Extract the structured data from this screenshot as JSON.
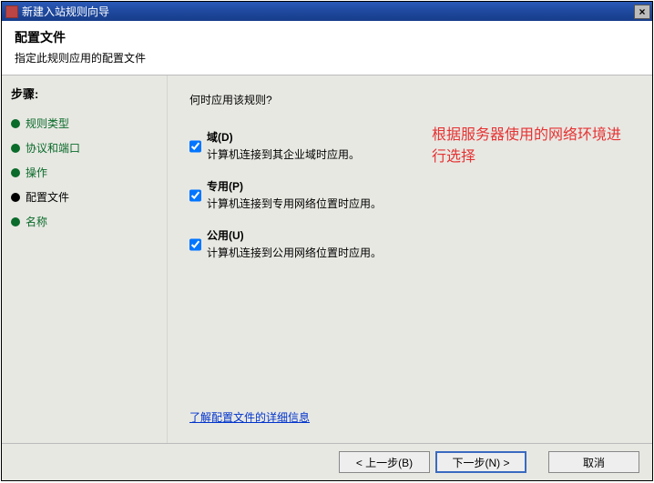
{
  "titlebar": {
    "title": "新建入站规则向导"
  },
  "header": {
    "title": "配置文件",
    "subtitle": "指定此规则应用的配置文件"
  },
  "sidebar": {
    "steps_title": "步骤:",
    "items": [
      {
        "label": "规则类型"
      },
      {
        "label": "协议和端口"
      },
      {
        "label": "操作"
      },
      {
        "label": "配置文件"
      },
      {
        "label": "名称"
      }
    ]
  },
  "main": {
    "prompt": "何时应用该规则?",
    "options": [
      {
        "label": "域(D)",
        "desc": "计算机连接到其企业域时应用。",
        "checked": true
      },
      {
        "label": "专用(P)",
        "desc": "计算机连接到专用网络位置时应用。",
        "checked": true
      },
      {
        "label": "公用(U)",
        "desc": "计算机连接到公用网络位置时应用。",
        "checked": true
      }
    ],
    "annotation": "根据服务器使用的网络环境进行选择",
    "link": "了解配置文件的详细信息"
  },
  "footer": {
    "back": "< 上一步(B)",
    "next": "下一步(N) >",
    "cancel": "取消"
  }
}
